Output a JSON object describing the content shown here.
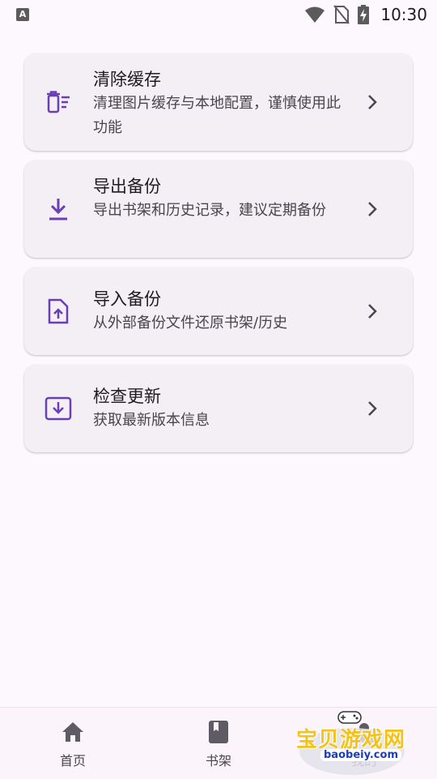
{
  "status_bar": {
    "app_badge": "A",
    "time": "10:30"
  },
  "cards": [
    {
      "title": "清除缓存",
      "description": "清理图片缓存与本地配置，谨慎使用此功能",
      "icon": "clear-all-icon"
    },
    {
      "title": "导出备份",
      "description": "导出书架和历史记录，建议定期备份",
      "icon": "download-icon"
    },
    {
      "title": "导入备份",
      "description": "从外部备份文件还原书架/历史",
      "icon": "upload-file-icon"
    },
    {
      "title": "检查更新",
      "description": "获取最新版本信息",
      "icon": "system-update-icon"
    }
  ],
  "bottom_nav": {
    "items": [
      {
        "label": "首页",
        "icon": "home-icon"
      },
      {
        "label": "书架",
        "icon": "book-icon"
      },
      {
        "label": "我的",
        "icon": "person-icon"
      }
    ]
  },
  "watermark": {
    "text": "宝贝游戏网",
    "url": "baobeiy.com"
  },
  "colors": {
    "accent": "#6a3fb5",
    "background": "#fdf7fe",
    "card": "#f4eff5",
    "watermark_text": "#f4c21a"
  }
}
